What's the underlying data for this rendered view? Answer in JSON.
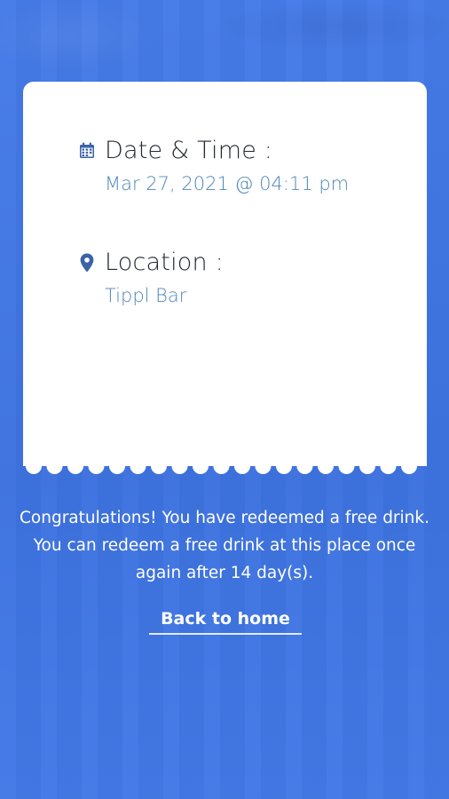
{
  "colors": {
    "background": "#3f76e6",
    "card": "#ffffff",
    "icon": "#3a63a8",
    "value_text": "#4f88b8"
  },
  "ticket": {
    "date_time": {
      "icon": "calendar-icon",
      "label": "Date & Time :",
      "value": "Mar 27, 2021 @ 04:11 pm"
    },
    "location": {
      "icon": "map-pin-icon",
      "label": "Location :",
      "value": "Tippl Bar"
    }
  },
  "message": {
    "text": "Congratulations! You have redeemed a free drink.  You can redeem a free drink at this place once again after 14 day(s)."
  },
  "actions": {
    "back_label": "Back to home"
  }
}
